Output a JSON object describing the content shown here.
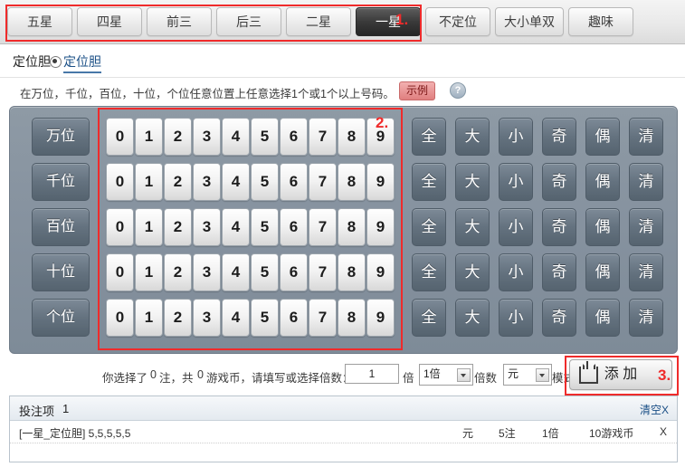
{
  "tabs": [
    {
      "label": "五星",
      "active": false
    },
    {
      "label": "四星",
      "active": false
    },
    {
      "label": "前三",
      "active": false
    },
    {
      "label": "后三",
      "active": false
    },
    {
      "label": "二星",
      "active": false
    },
    {
      "label": "一星",
      "active": true
    },
    {
      "label": "不定位",
      "active": false
    },
    {
      "label": "大小单双",
      "active": false
    },
    {
      "label": "趣味",
      "active": false
    }
  ],
  "annotations": [
    {
      "num": "1."
    },
    {
      "num": "2."
    },
    {
      "num": "3."
    }
  ],
  "subhead": {
    "label": "定位胆",
    "selected": "定位胆"
  },
  "instruction": {
    "text": "在万位，千位，百位，十位，个位任意位置上任意选择1个或1个以上号码。",
    "example_label": "示例",
    "help_icon": "?"
  },
  "board": {
    "rows": [
      {
        "position": "万位",
        "numbers": [
          "0",
          "1",
          "2",
          "3",
          "4",
          "5",
          "6",
          "7",
          "8",
          "9"
        ]
      },
      {
        "position": "千位",
        "numbers": [
          "0",
          "1",
          "2",
          "3",
          "4",
          "5",
          "6",
          "7",
          "8",
          "9"
        ]
      },
      {
        "position": "百位",
        "numbers": [
          "0",
          "1",
          "2",
          "3",
          "4",
          "5",
          "6",
          "7",
          "8",
          "9"
        ]
      },
      {
        "position": "十位",
        "numbers": [
          "0",
          "1",
          "2",
          "3",
          "4",
          "5",
          "6",
          "7",
          "8",
          "9"
        ]
      },
      {
        "position": "个位",
        "numbers": [
          "0",
          "1",
          "2",
          "3",
          "4",
          "5",
          "6",
          "7",
          "8",
          "9"
        ]
      }
    ],
    "actions": [
      "全",
      "大",
      "小",
      "奇",
      "偶",
      "清"
    ]
  },
  "betline": {
    "prefix": "你选择了",
    "bet_count": "0",
    "mid1": "注，共",
    "coin_count": "0",
    "mid2": "游戏币，请填写或选择倍数：",
    "multiple_value": "1",
    "unit_label": "倍",
    "multiple_select": "1倍",
    "times_label": "倍数",
    "mode_select": "元",
    "mode_label": "模式",
    "add_button": "添 加"
  },
  "betlist": {
    "title": "投注项",
    "count": "1",
    "clear_label": "清空X",
    "rows": [
      {
        "desc": "[一星_定位胆] 5,5,5,5,5",
        "unit": "元",
        "notes": "5注",
        "multiple": "1倍",
        "coins": "10游戏币",
        "x": "X",
        "delete": "X"
      }
    ]
  }
}
